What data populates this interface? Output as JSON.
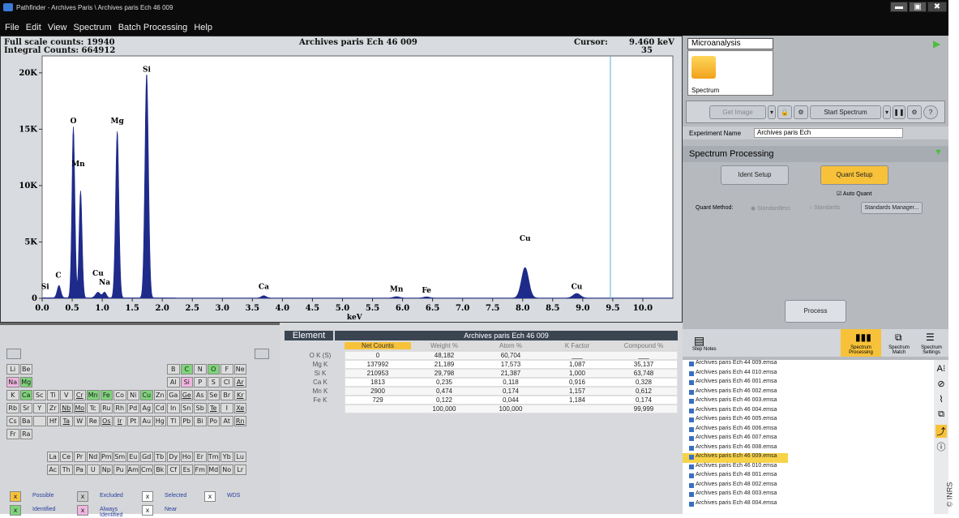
{
  "window": {
    "title": "Pathfinder - Archives Paris \\ Archives paris Ech 46 009",
    "min": "▬",
    "max": "▣",
    "close": "✖"
  },
  "menu": [
    "File",
    "Edit",
    "View",
    "Spectrum",
    "Batch Processing",
    "Help"
  ],
  "spectrum": {
    "full_scale": "Full scale counts: 19940",
    "integral": "Integral Counts: 664912",
    "title": "Archives paris Ech 46 009",
    "cursor_label": "Cursor:",
    "cursor_kev": "9.460 keV",
    "cursor_counts": "35 Counts",
    "xlabel": "keV",
    "x_ticks": [
      "0.0",
      "0.5",
      "1.0",
      "1.5",
      "2.0",
      "2.5",
      "3.0",
      "3.5",
      "4.0",
      "4.5",
      "5.0",
      "5.5",
      "6.0",
      "6.5",
      "7.0",
      "7.5",
      "8.0",
      "8.5",
      "9.0",
      "9.5",
      "10.0"
    ],
    "y_ticks": [
      "0",
      "5K",
      "10K",
      "15K",
      "20K"
    ],
    "peak_labels": [
      {
        "t": "Si",
        "kev": 0.05,
        "c": 600
      },
      {
        "t": "C",
        "kev": 0.27,
        "c": 1600
      },
      {
        "t": "O",
        "kev": 0.52,
        "c": 15300
      },
      {
        "t": "Mn",
        "kev": 0.6,
        "c": 11500
      },
      {
        "t": "Cu",
        "kev": 0.93,
        "c": 1800
      },
      {
        "t": "Na",
        "kev": 1.04,
        "c": 1000
      },
      {
        "t": "Mg",
        "kev": 1.25,
        "c": 15300
      },
      {
        "t": "Si",
        "kev": 1.74,
        "c": 19900
      },
      {
        "t": "Ca",
        "kev": 3.69,
        "c": 600
      },
      {
        "t": "Mn",
        "kev": 5.9,
        "c": 400
      },
      {
        "t": "Fe",
        "kev": 6.4,
        "c": 300
      },
      {
        "t": "Cu",
        "kev": 8.04,
        "c": 4900
      },
      {
        "t": "Cu",
        "kev": 8.9,
        "c": 600
      }
    ]
  },
  "chart_data": {
    "type": "area",
    "title": "Archives paris Ech 46 009",
    "xlabel": "keV",
    "ylabel": "",
    "xlim": [
      0,
      10.5
    ],
    "ylim": [
      0,
      21500
    ],
    "peaks": [
      {
        "kev": 0.28,
        "counts": 1100,
        "w": 0.03
      },
      {
        "kev": 0.52,
        "counts": 15200,
        "w": 0.025
      },
      {
        "kev": 0.64,
        "counts": 9500,
        "w": 0.025
      },
      {
        "kev": 0.93,
        "counts": 500,
        "w": 0.04
      },
      {
        "kev": 1.04,
        "counts": 500,
        "w": 0.03
      },
      {
        "kev": 1.25,
        "counts": 14800,
        "w": 0.028
      },
      {
        "kev": 1.74,
        "counts": 19940,
        "w": 0.03
      },
      {
        "kev": 3.69,
        "counts": 200,
        "w": 0.04
      },
      {
        "kev": 5.9,
        "counts": 120,
        "w": 0.05
      },
      {
        "kev": 6.4,
        "counts": 100,
        "w": 0.05
      },
      {
        "kev": 8.04,
        "counts": 2700,
        "w": 0.06
      },
      {
        "kev": 8.9,
        "counts": 400,
        "w": 0.06
      }
    ],
    "cursor_kev": 9.46
  },
  "periodic": {
    "rows": [
      [
        [
          "Li",
          ""
        ],
        [
          "Be",
          ""
        ],
        [
          "B",
          ""
        ],
        [
          "C",
          "g"
        ],
        [
          "N",
          ""
        ],
        [
          "O",
          "g"
        ],
        [
          "F",
          ""
        ],
        [
          "Ne",
          ""
        ]
      ],
      [
        [
          "Na",
          "m"
        ],
        [
          "Mg",
          "g"
        ],
        [
          "Al",
          ""
        ],
        [
          "Si",
          "m"
        ],
        [
          "P",
          ""
        ],
        [
          "S",
          ""
        ],
        [
          "Cl",
          ""
        ],
        [
          "Ar",
          "u"
        ]
      ],
      [
        [
          "K",
          ""
        ],
        [
          "Ca",
          "g"
        ],
        [
          "Sc",
          ""
        ],
        [
          "Ti",
          ""
        ],
        [
          "V",
          ""
        ],
        [
          "Cr",
          "u"
        ],
        [
          "Mn",
          "g"
        ],
        [
          "Fe",
          "g"
        ],
        [
          "Co",
          ""
        ],
        [
          "Ni",
          ""
        ],
        [
          "Cu",
          "g"
        ],
        [
          "Zn",
          ""
        ],
        [
          "Ga",
          ""
        ],
        [
          "Ge",
          "u"
        ],
        [
          "As",
          ""
        ],
        [
          "Se",
          ""
        ],
        [
          "Br",
          ""
        ],
        [
          "Kr",
          "u"
        ]
      ],
      [
        [
          "Rb",
          ""
        ],
        [
          "Sr",
          ""
        ],
        [
          "Y",
          ""
        ],
        [
          "Zr",
          ""
        ],
        [
          "Nb",
          "u"
        ],
        [
          "Mo",
          "u"
        ],
        [
          "Tc",
          ""
        ],
        [
          "Ru",
          ""
        ],
        [
          "Rh",
          ""
        ],
        [
          "Pd",
          ""
        ],
        [
          "Ag",
          ""
        ],
        [
          "Cd",
          ""
        ],
        [
          "In",
          ""
        ],
        [
          "Sn",
          ""
        ],
        [
          "Sb",
          ""
        ],
        [
          "Te",
          "u"
        ],
        [
          "I",
          ""
        ],
        [
          "Xe",
          "u"
        ]
      ],
      [
        [
          "Cs",
          ""
        ],
        [
          "Ba",
          ""
        ],
        [
          "",
          ""
        ],
        [
          "Hf",
          ""
        ],
        [
          "Ta",
          "u"
        ],
        [
          "W",
          ""
        ],
        [
          "Re",
          ""
        ],
        [
          "Os",
          "u"
        ],
        [
          "Ir",
          "u"
        ],
        [
          "Pt",
          ""
        ],
        [
          "Au",
          ""
        ],
        [
          "Hg",
          ""
        ],
        [
          "Tl",
          ""
        ],
        [
          "Pb",
          ""
        ],
        [
          "Bi",
          ""
        ],
        [
          "Po",
          ""
        ],
        [
          "At",
          ""
        ],
        [
          "Rn",
          "u"
        ]
      ],
      [
        [
          "Fr",
          ""
        ],
        [
          "Ra",
          ""
        ]
      ],
      [
        [
          "La",
          ""
        ],
        [
          "Ce",
          ""
        ],
        [
          "Pr",
          ""
        ],
        [
          "Nd",
          ""
        ],
        [
          "Pm",
          ""
        ],
        [
          "Sm",
          ""
        ],
        [
          "Eu",
          ""
        ],
        [
          "Gd",
          ""
        ],
        [
          "Tb",
          ""
        ],
        [
          "Dy",
          ""
        ],
        [
          "Ho",
          ""
        ],
        [
          "Er",
          ""
        ],
        [
          "Tm",
          ""
        ],
        [
          "Yb",
          ""
        ],
        [
          "Lu",
          ""
        ]
      ],
      [
        [
          "Ac",
          ""
        ],
        [
          "Th",
          ""
        ],
        [
          "Pa",
          ""
        ],
        [
          "U",
          ""
        ],
        [
          "Np",
          ""
        ],
        [
          "Pu",
          ""
        ],
        [
          "Am",
          ""
        ],
        [
          "Cm",
          ""
        ],
        [
          "Bk",
          ""
        ],
        [
          "Cf",
          ""
        ],
        [
          "Es",
          ""
        ],
        [
          "Fm",
          ""
        ],
        [
          "Md",
          ""
        ],
        [
          "No",
          ""
        ],
        [
          "Lr",
          ""
        ]
      ]
    ],
    "legend": [
      "Possible",
      "Excluded",
      "Selected",
      "WDS",
      "Identified",
      "Always Identified",
      "Near"
    ],
    "x": "x"
  },
  "results": {
    "element_header": "Element",
    "sample": "Archives paris Ech 46 009",
    "columns": [
      "Net Counts",
      "Weight %",
      "Atom %",
      "K Factor",
      "Compound %"
    ],
    "rows": [
      [
        "O K (S)",
        "0",
        "48,182",
        "60,704",
        "___",
        "___"
      ],
      [
        "Mg K",
        "137992",
        "21,189",
        "17,573",
        "1,087",
        "35,137"
      ],
      [
        "Si K",
        "210953",
        "29,798",
        "21,387",
        "1,000",
        "63,748"
      ],
      [
        "Ca K",
        "1813",
        "0,235",
        "0,118",
        "0,916",
        "0,328"
      ],
      [
        "Mn K",
        "2900",
        "0,474",
        "0,174",
        "1,157",
        "0,612"
      ],
      [
        "Fe K",
        "729",
        "0,122",
        "0,044",
        "1,184",
        "0,174"
      ],
      [
        "",
        "",
        "100,000",
        "100,000",
        "",
        "99,999"
      ]
    ]
  },
  "right": {
    "tab": "Microanalysis",
    "tab_item": "Spectrum",
    "get_image": "Get Image",
    "start_spectrum": "Start Spectrum",
    "experiment_label": "Experiment Name",
    "experiment_value": "Archives paris Ech",
    "processing_title": "Spectrum Processing",
    "ident_setup": "Ident Setup",
    "quant_setup": "Quant Setup",
    "auto_quant": "Auto Quant",
    "quant_method": "Quant Method:",
    "standardless": "Standardless",
    "standards": "Standards",
    "standards_manager": "Standards Manager...",
    "process": "Process",
    "step_notes": "Step Notes",
    "bottom_tabs": [
      "Spectrum Processing",
      "Spectrum Match",
      "Spectrum Settings"
    ],
    "files": [
      "Archives paris Ech 44 009.emsa",
      "Archives paris Ech 44 010.emsa",
      "Archives paris Ech 46 001.emsa",
      "Archives paris Ech 46 002.emsa",
      "Archives paris Ech 46 003.emsa",
      "Archives paris Ech 46 004.emsa",
      "Archives paris Ech 46 005.emsa",
      "Archives paris Ech 46 006.emsa",
      "Archives paris Ech 46 007.emsa",
      "Archives paris Ech 46 008.emsa",
      "Archives paris Ech 46 009.emsa",
      "Archives paris Ech 46 010.emsa",
      "Archives paris Ech 48 001.emsa",
      "Archives paris Ech 48 002.emsa",
      "Archives paris Ech 48 003.emsa",
      "Archives paris Ech 48 004.emsa"
    ],
    "selected_file": 10,
    "tools": [
      "A⁝",
      "⊘",
      "⌇",
      "⧉",
      "⤴",
      "ⓘ"
    ]
  },
  "copyright": "© INRS",
  "colors": {
    "spectrum": "#1e2b8a",
    "accent": "#f7c23a",
    "plot_bg": "#ffffff"
  }
}
